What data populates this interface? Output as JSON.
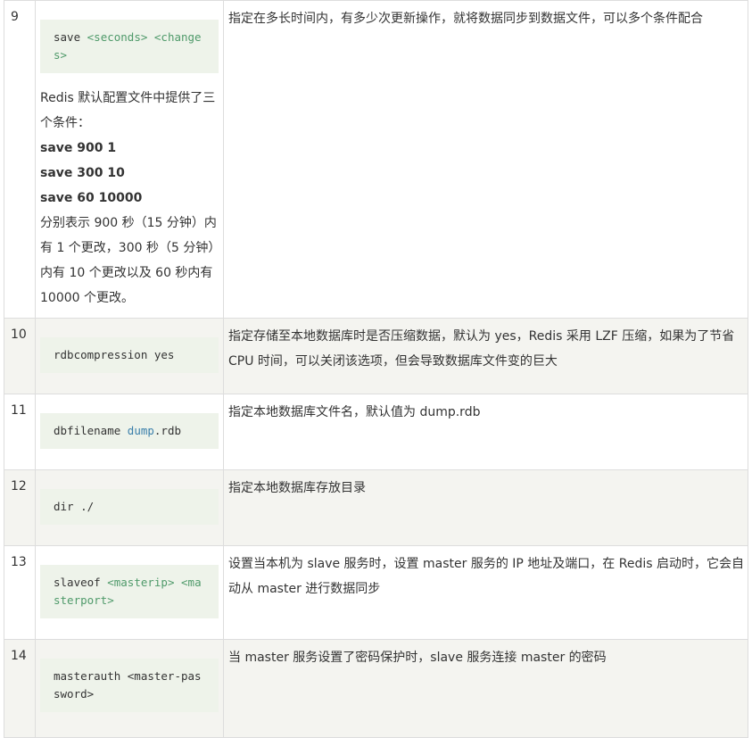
{
  "colors": {
    "border": "#dddddd",
    "row_alt_bg": "#f4f4f0",
    "code_bg": "#eef3ea",
    "placeholder_green": "#4f9a6a",
    "value_blue": "#3a7faa"
  },
  "rows": [
    {
      "num": "9",
      "code": {
        "kw": "save",
        "p1": "<seconds>",
        "p2": "<changes>"
      },
      "note": {
        "intro": "Redis 默认配置文件中提供了三个条件：",
        "bold": [
          "save 900 1",
          "save 300 10",
          "save 60 10000"
        ],
        "outro": "分别表示 900 秒（15 分钟）内有 1 个更改，300 秒（5 分钟）内有 10 个更改以及 60 秒内有 10000 个更改。"
      },
      "desc": "指定在多长时间内，有多少次更新操作，就将数据同步到数据文件，可以多个条件配合"
    },
    {
      "num": "10",
      "code": {
        "text": "rdbcompression yes"
      },
      "desc": "指定存储至本地数据库时是否压缩数据，默认为 yes，Redis 采用 LZF 压缩，如果为了节省 CPU 时间，可以关闭该选项，但会导致数据库文件变的巨大"
    },
    {
      "num": "11",
      "code": {
        "kw": "dbfilename",
        "val": "dump",
        "rest": ".rdb"
      },
      "desc": "指定本地数据库文件名，默认值为 dump.rdb"
    },
    {
      "num": "12",
      "code": {
        "text": "dir ./"
      },
      "desc": "指定本地数据库存放目录"
    },
    {
      "num": "13",
      "code": {
        "kw": "slaveof",
        "p1": "<masterip>",
        "p2": "<masterport>"
      },
      "desc": "设置当本机为 slave 服务时，设置 master 服务的 IP 地址及端口，在 Redis 启动时，它会自动从 master 进行数据同步"
    },
    {
      "num": "14",
      "code": {
        "text": "masterauth <master-password>"
      },
      "desc": "当 master 服务设置了密码保护时，slave 服务连接 master 的密码"
    }
  ]
}
